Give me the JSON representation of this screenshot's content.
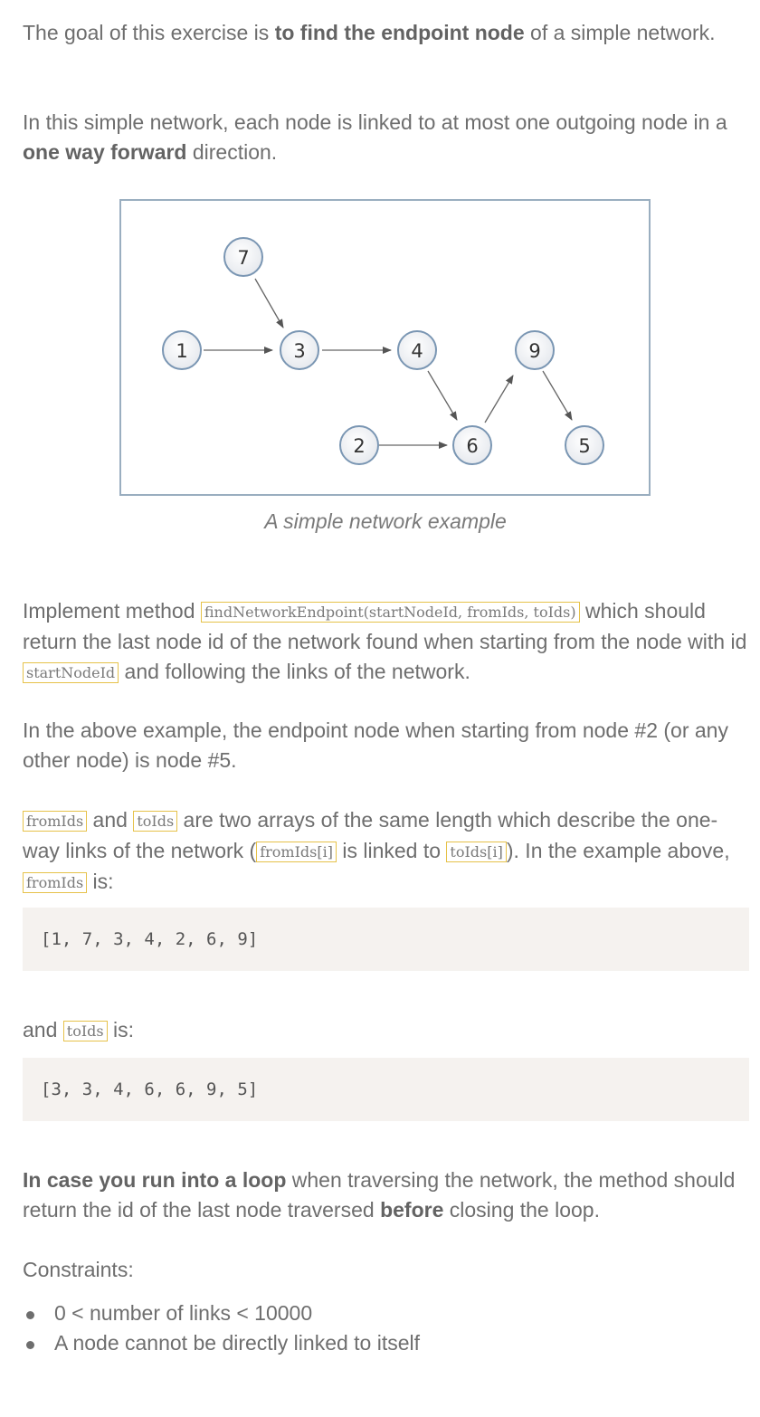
{
  "intro": {
    "a": "The goal of this exercise is ",
    "b": "to find the endpoint node",
    "c": " of a simple network."
  },
  "intro2": {
    "a": "In this simple network, each node is linked to at most one outgoing node in a ",
    "b": "one way forward",
    "c": " direction."
  },
  "figure": {
    "caption": "A simple network example",
    "nodes": [
      "7",
      "1",
      "3",
      "4",
      "9",
      "2",
      "6",
      "5"
    ]
  },
  "method": {
    "a": "Implement method ",
    "code1": "findNetworkEndpoint(startNodeId, fromIds, toIds)",
    "b": " which should return the last node id of the network found when starting from the node with id ",
    "code2": "startNodeId",
    "c": " and following the links of the network."
  },
  "example": {
    "text": "In the above example, the endpoint node when starting from node #2 (or any other node) is node #5."
  },
  "arrays": {
    "code1": "fromIds",
    "a": " and ",
    "code2": "toIds",
    "b": " are two arrays of the same length which describe the one-way links of the network (",
    "code3": "fromIds[i]",
    "c": " is linked to ",
    "code4": "toIds[i]",
    "d": "). In the example above, ",
    "code5": "fromIds",
    "e": " is:"
  },
  "fromIds_block": "[1, 7, 3, 4, 2, 6, 9]",
  "toids_line": {
    "a": "and ",
    "code": "toIds",
    "b": " is:"
  },
  "toIds_block": "[3, 3, 4, 6, 6, 9, 5]",
  "loop": {
    "b1": "In case you run into a loop",
    "a": " when traversing the network, the method should return the id of the last node traversed ",
    "b2": "before",
    "c": " closing the loop."
  },
  "constraints": {
    "title": "Constraints:",
    "items": [
      "0 < number of links < 10000",
      "A node cannot be directly linked to itself"
    ]
  }
}
